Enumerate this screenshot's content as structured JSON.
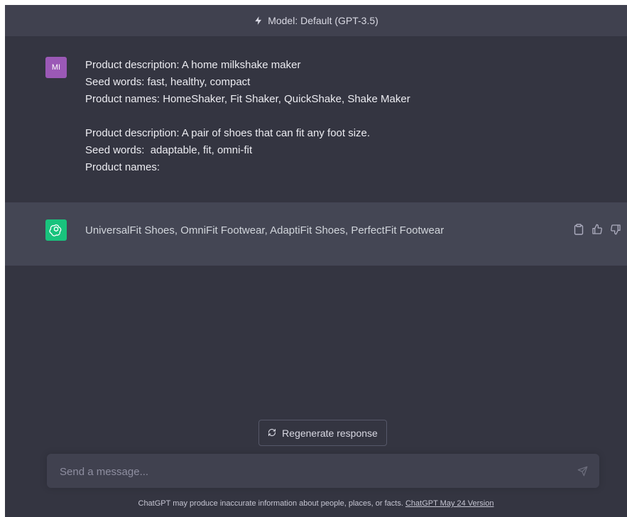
{
  "header": {
    "model_label": "Model: Default (GPT-3.5)"
  },
  "user_message": {
    "avatar_initials": "MI",
    "lines": [
      "Product description: A home milkshake maker",
      "Seed words: fast, healthy, compact",
      "Product names: HomeShaker, Fit Shaker, QuickShake, Shake Maker",
      "",
      "Product description: A pair of shoes that can fit any foot size.",
      "Seed words:  adaptable, fit, omni-fit",
      "Product names:"
    ]
  },
  "assistant_message": {
    "text": "UniversalFit Shoes, OmniFit Footwear, AdaptiFit Shoes, PerfectFit Footwear",
    "actions": [
      "copy-icon",
      "thumbs-up-icon",
      "thumbs-down-icon"
    ]
  },
  "regenerate": {
    "label": "Regenerate response"
  },
  "composer": {
    "placeholder": "Send a message...",
    "value": ""
  },
  "footer": {
    "disclaimer": "ChatGPT may produce inaccurate information about people, places, or facts. ",
    "version_link": "ChatGPT May 24 Version"
  },
  "colors": {
    "background": "#343541",
    "assistant_bg": "#444654",
    "input_bg": "#40414f",
    "user_avatar": "#9b59b6",
    "gpt_avatar": "#19c37d"
  }
}
